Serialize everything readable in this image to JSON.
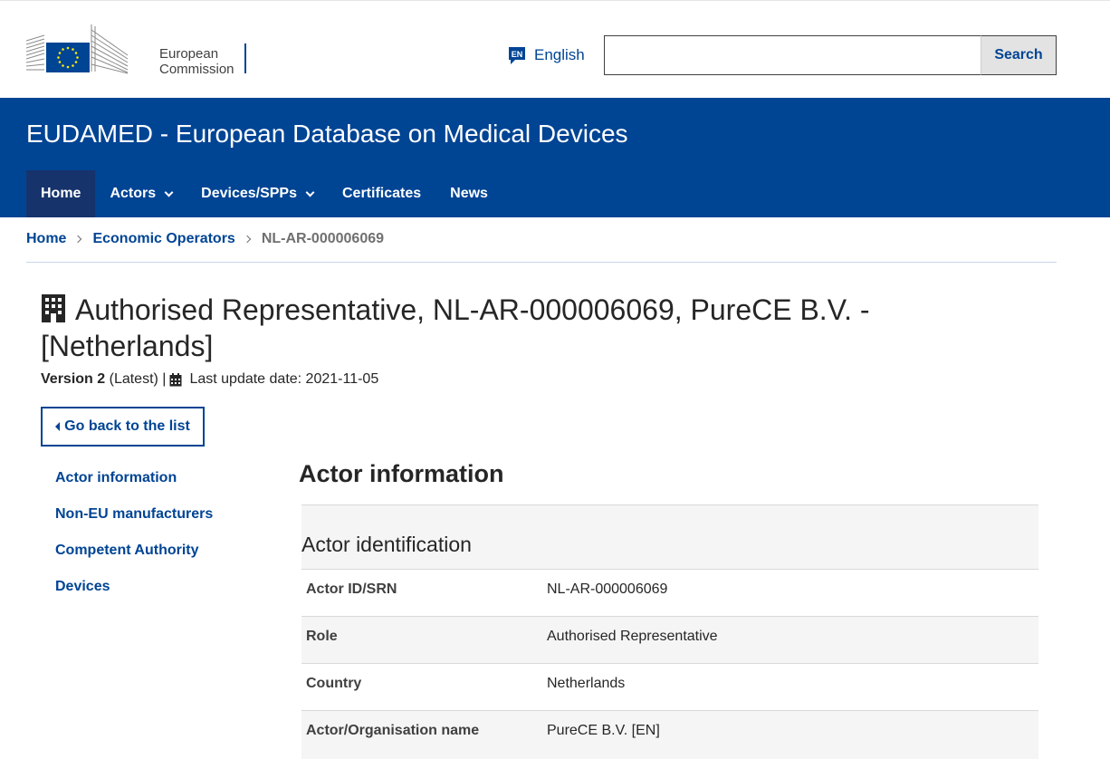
{
  "header": {
    "logo_line1": "European",
    "logo_line2": "Commission",
    "lang_code": "EN",
    "lang_label": "English",
    "search_placeholder": "",
    "search_button": "Search"
  },
  "banner": {
    "site_title": "EUDAMED - European Database on Medical Devices"
  },
  "nav": {
    "items": [
      {
        "label": "Home",
        "active": true
      },
      {
        "label": "Actors",
        "dropdown": true
      },
      {
        "label": "Devices/SPPs",
        "dropdown": true
      },
      {
        "label": "Certificates"
      },
      {
        "label": "News"
      }
    ]
  },
  "breadcrumb": {
    "items": [
      "Home",
      "Economic Operators"
    ],
    "current": "NL-AR-000006069"
  },
  "page": {
    "title": "Authorised Representative, NL-AR-000006069, PureCE B.V. - [Netherlands]",
    "version_label": "Version 2",
    "version_suffix": "(Latest) |",
    "last_update": "Last update date: 2021-11-05",
    "back_button": "Go back to the list"
  },
  "side_nav": {
    "items": [
      "Actor information",
      "Non-EU manufacturers",
      "Competent Authority",
      "Devices"
    ]
  },
  "main": {
    "section_title": "Actor information",
    "card_title": "Actor identification",
    "rows": [
      {
        "key": "Actor ID/SRN",
        "value": "NL-AR-000006069"
      },
      {
        "key": "Role",
        "value": "Authorised Representative"
      },
      {
        "key": "Country",
        "value": "Netherlands"
      },
      {
        "key": "Actor/Organisation name",
        "value": "PureCE B.V. [EN]"
      }
    ]
  },
  "colors": {
    "brand_blue": "#004494",
    "nav_active": "#16336b",
    "eu_yellow": "#ffed00"
  }
}
